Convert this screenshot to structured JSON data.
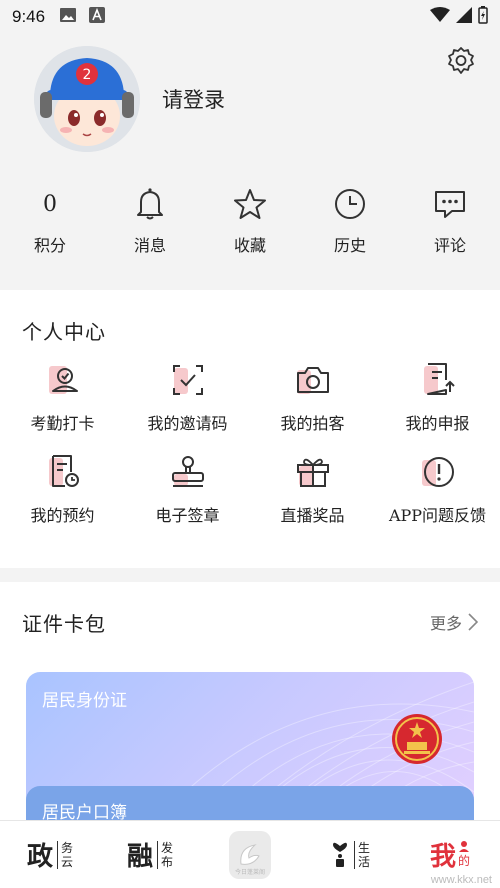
{
  "status_bar": {
    "time": "9:46"
  },
  "profile": {
    "login_text": "请登录",
    "avatar_char": "2"
  },
  "stats": [
    {
      "value": "0",
      "label": "积分"
    },
    {
      "label": "消息",
      "icon": "bell-icon"
    },
    {
      "label": "收藏",
      "icon": "star-icon"
    },
    {
      "label": "历史",
      "icon": "clock-icon"
    },
    {
      "label": "评论",
      "icon": "comment-icon"
    }
  ],
  "personal_center": {
    "title": "个人中心",
    "items": [
      {
        "label": "考勤打卡",
        "icon": "checkin-icon"
      },
      {
        "label": "我的邀请码",
        "icon": "scan-code-icon"
      },
      {
        "label": "我的拍客",
        "icon": "camera-icon"
      },
      {
        "label": "我的申报",
        "icon": "upload-doc-icon"
      },
      {
        "label": "我的预约",
        "icon": "appointment-icon"
      },
      {
        "label": "电子签章",
        "icon": "stamp-icon"
      },
      {
        "label": "直播奖品",
        "icon": "gift-icon"
      },
      {
        "label": "APP问题反馈",
        "icon": "feedback-icon"
      }
    ]
  },
  "wallet": {
    "title": "证件卡包",
    "more": "更多",
    "id_card": "居民身份证",
    "hukou": "居民户口簿"
  },
  "tabbar": [
    {
      "big": "政",
      "small1": "务",
      "small2": "云"
    },
    {
      "big": "融",
      "small1": "发",
      "small2": "布"
    },
    {
      "center_caption": "今日蓬莱阁"
    },
    {
      "small1": "生",
      "small2": "活"
    },
    {
      "big": "我",
      "small1": "的"
    }
  ],
  "watermark": "www.kkx.net",
  "colors": {
    "accent": "#e0323c",
    "icon_pink": "#f6c9cc",
    "card_blue": "#a9c4ff"
  }
}
